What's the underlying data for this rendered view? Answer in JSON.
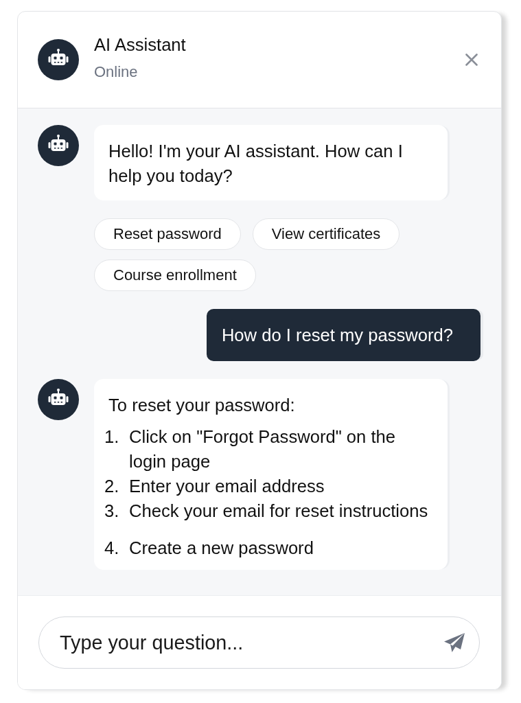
{
  "header": {
    "title": "AI Assistant",
    "status": "Online"
  },
  "messages": [
    {
      "kind": "bot",
      "text": "Hello! I'm your AI assistant. How can I help you today?",
      "suggestions": [
        "Reset password",
        "View certificates",
        "Course enrollment"
      ]
    },
    {
      "kind": "user",
      "text": "How do I reset my password?"
    },
    {
      "kind": "bot",
      "text": "To reset your password:",
      "step_groups": [
        {
          "steps": [
            {
              "number": "1.",
              "text": "Click on \"Forgot Password\" on the login page"
            },
            {
              "number": "2.",
              "text": "Enter your email address"
            },
            {
              "number": "3.",
              "text": "Check your email for reset instructions"
            }
          ]
        },
        {
          "steps": [
            {
              "number": "4.",
              "text": "Create a new password"
            }
          ]
        }
      ]
    }
  ],
  "input": {
    "placeholder": "Type your question..."
  }
}
